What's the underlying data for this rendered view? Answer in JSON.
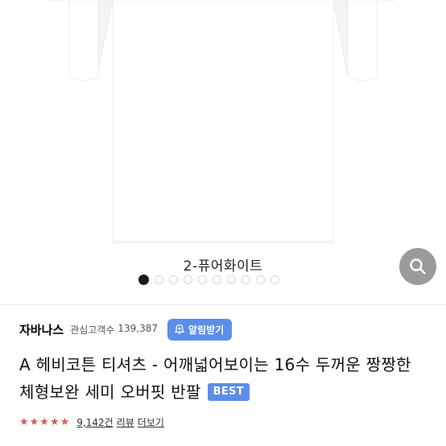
{
  "gallery": {
    "variant_caption": "2-퓨어화이트",
    "dot_count": 10,
    "active_index": 0
  },
  "brand": {
    "name": "자바나스",
    "followers_label": "관심고객수",
    "followers_count": "139,387",
    "alarm_button": "알림받기"
  },
  "product": {
    "title": "A 헤비코튼 티셔츠 - 어깨넓어보이는 16수 두꺼운 짱짱한 체형보완 세미 오버핏 반팔",
    "badge": "BEST"
  },
  "rating": {
    "stars": "★★★★★",
    "review_count": "9,142건",
    "review_label": "리뷰",
    "more": "더보기"
  },
  "colors": {
    "accent": "#5b8ee8",
    "star": "#e25555",
    "active_dot": "#1a1a1a"
  }
}
